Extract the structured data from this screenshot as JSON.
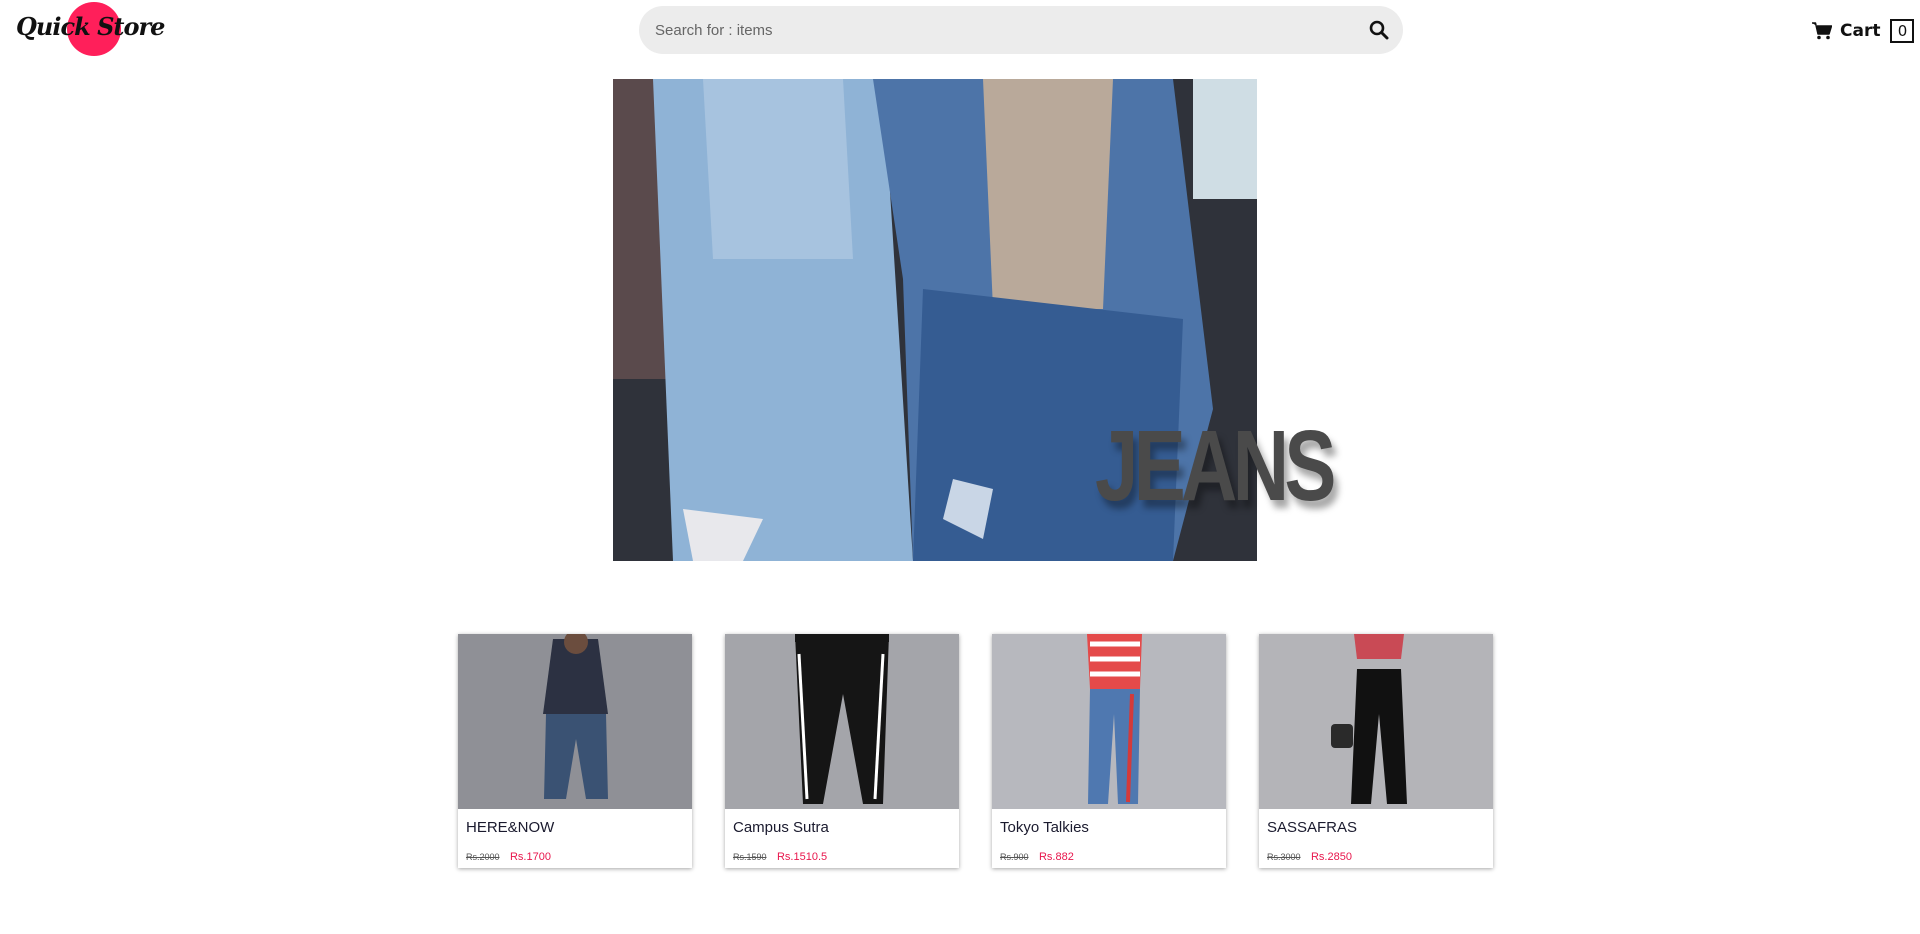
{
  "header": {
    "logo_text": "Quick Store",
    "search_placeholder": "Search for : items",
    "cart_label": "Cart",
    "cart_count": "0"
  },
  "hero": {
    "title": "JEANS"
  },
  "products": [
    {
      "name": "HERE&NOW",
      "old_price": "Rs.2000",
      "price": "Rs.1700"
    },
    {
      "name": "Campus Sutra",
      "old_price": "Rs.1590",
      "price": "Rs.1510.5"
    },
    {
      "name": "Tokyo Talkies",
      "old_price": "Rs.900",
      "price": "Rs.882"
    },
    {
      "name": "SASSAFRAS",
      "old_price": "Rs.3000",
      "price": "Rs.2850"
    }
  ],
  "icons": {
    "search": "search-icon",
    "cart": "cart-icon"
  },
  "colors": {
    "brand": "#ff1f5a",
    "price": "#e8164c",
    "search_bg": "#ececec"
  }
}
